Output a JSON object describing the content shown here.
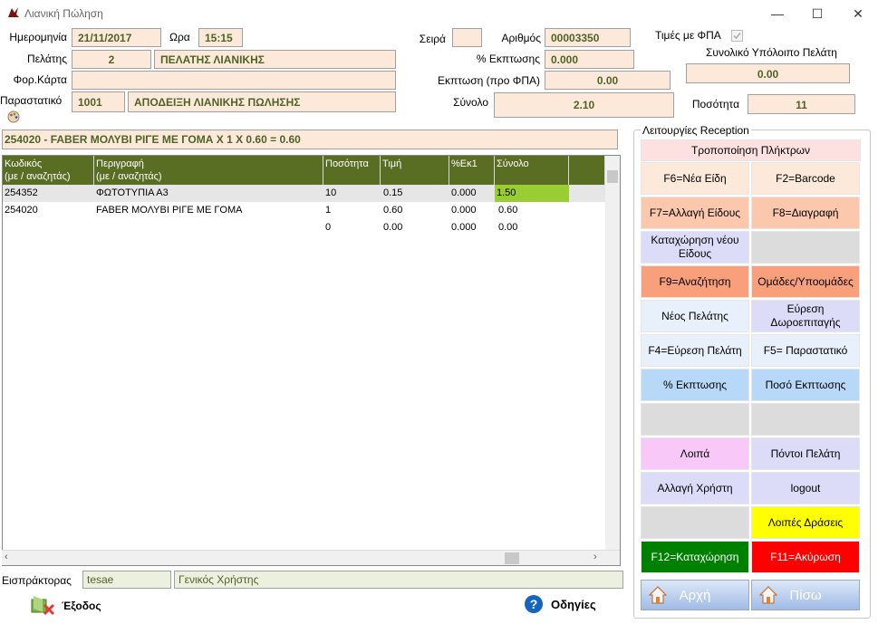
{
  "window": {
    "title": "Λιανική Πώληση",
    "minimize": "—",
    "maximize": "☐",
    "close": "✕"
  },
  "header": {
    "date_label": "Ημερομηνία",
    "date_value": "21/11/2017",
    "time_label": "Ωρα",
    "time_value": "15:15",
    "series_label": "Σειρά",
    "series_value": "",
    "number_label": "Αριθμός",
    "number_value": "00003350",
    "vat_prices_label": "Τιμές με ΦΠΑ",
    "customer_label": "Πελάτης",
    "customer_code": "2",
    "customer_name": "ΠΕΛΑΤΗΣ ΛΙΑΝΙΚΗΣ",
    "discount_pct_label": "% Εκπτωσης",
    "discount_pct_value": "0.000",
    "balance_label": "Συνολικό Υπόλοιπο Πελάτη",
    "balance_value": "0.00",
    "tax_card_label": "Φορ.Κάρτα",
    "tax_card_value": "",
    "discount_pre_vat_label": "Εκπτωση (προ ΦΠΑ)",
    "discount_pre_vat_value": "0.00",
    "document_label": "Παραστατικό",
    "document_code": "1001",
    "document_name": "ΑΠΟΔΕΙΞΗ ΛΙΑΝΙΚΗΣ ΠΩΛΗΣΗΣ",
    "total_label": "Σύνολο",
    "total_value": "2.10",
    "quantity_label": "Ποσότητα",
    "quantity_value": "11"
  },
  "info_line": "254020 - FABER ΜΟΛΥΒΙ ΡΙΓΕ ΜΕ ΓΟΜΑ X 1 X 0.60 = 0.60",
  "grid": {
    "columns": [
      "Κωδικός\n(με / αναζητάς)",
      "Περιγραφή\n(με / αναζητάς)",
      "Ποσότητα",
      "Τιμή",
      "%Εκ1",
      "Σύνολο",
      ""
    ],
    "rows": [
      [
        "254352",
        "ΦΩΤΟΤΥΠΙΑ Α3",
        "10",
        "0.15",
        "0.000",
        "1.50"
      ],
      [
        "254020",
        "FABER ΜΟΛΥΒΙ ΡΙΓΕ ΜΕ ΓΟΜΑ",
        "1",
        "0.60",
        "0.000",
        "0.60"
      ],
      [
        "",
        "",
        "0",
        "0.00",
        "0.000",
        "0.00"
      ]
    ]
  },
  "footer": {
    "cashier_label": "Εισπράκτορας",
    "cashier_user": "tesae",
    "cashier_name": "Γενικός Χρήστης",
    "exit_label": "Έξοδος",
    "help_label": "Οδηγίες"
  },
  "panel": {
    "title": "Λειτουργίες Reception",
    "header_button": "Τροποποίηση Πλήκτρων",
    "buttons": [
      {
        "label": "F6=Νέα Είδη",
        "bg": "#fde9d9",
        "fg": "#000000"
      },
      {
        "label": "F2=Barcode",
        "bg": "#fde9d9",
        "fg": "#000000"
      },
      {
        "label": "F7=Αλλαγή Είδους",
        "bg": "#fbc8ad",
        "fg": "#000000"
      },
      {
        "label": "F8=Διαγραφή",
        "bg": "#fbc8ad",
        "fg": "#000000"
      },
      {
        "label": "Καταχώρηση νέου Είδους",
        "bg": "#dcdcf8",
        "fg": "#000000"
      },
      {
        "label": "",
        "bg": "#dcdcdc",
        "fg": "#000000"
      },
      {
        "label": "F9=Αναζήτηση",
        "bg": "#f8a07b",
        "fg": "#000000"
      },
      {
        "label": "Ομάδες/Υποομάδες",
        "bg": "#f8a07b",
        "fg": "#000000"
      },
      {
        "label": "Νέος Πελάτης",
        "bg": "#e8f0fc",
        "fg": "#000000"
      },
      {
        "label": "Εύρεση Δωροεπιταγής",
        "bg": "#dcdcf8",
        "fg": "#000000"
      },
      {
        "label": "F4=Εύρεση Πελάτη",
        "bg": "#e8f0fc",
        "fg": "#000000"
      },
      {
        "label": "F5= Παραστατικό",
        "bg": "#e8f0fc",
        "fg": "#000000"
      },
      {
        "label": "% Εκπτωσης",
        "bg": "#b8d8f8",
        "fg": "#000000"
      },
      {
        "label": "Ποσό Εκπτωσης",
        "bg": "#b8d8f8",
        "fg": "#000000"
      },
      {
        "label": "",
        "bg": "#dcdcdc",
        "fg": "#000000"
      },
      {
        "label": "",
        "bg": "#dcdcdc",
        "fg": "#000000"
      },
      {
        "label": "Λοιπά",
        "bg": "#f8c8f8",
        "fg": "#000000"
      },
      {
        "label": "Πόντοι Πελάτη",
        "bg": "#dcdcf8",
        "fg": "#000000"
      },
      {
        "label": "Αλλαγή Χρήστη",
        "bg": "#dcdcf8",
        "fg": "#000000"
      },
      {
        "label": "logout",
        "bg": "#dcdcf8",
        "fg": "#000000"
      },
      {
        "label": "",
        "bg": "#dcdcdc",
        "fg": "#000000"
      },
      {
        "label": "Λοιπές Δράσεις",
        "bg": "#ffff00",
        "fg": "#000000"
      },
      {
        "label": "F12=Καταχώρηση",
        "bg": "#008000",
        "fg": "#ffffff"
      },
      {
        "label": "F11=Ακύρωση",
        "bg": "#ff0000",
        "fg": "#ffffff"
      }
    ],
    "home_label": "Αρχή",
    "back_label": "Πίσω"
  },
  "colors": {
    "field_bg": "#fde9d9",
    "grid_header": "#5a6e23",
    "selected_cell": "#9acd32",
    "text_olive": "#4f6228"
  }
}
